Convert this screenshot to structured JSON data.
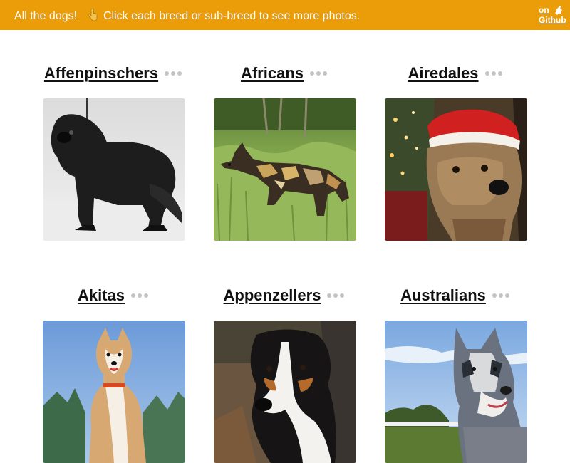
{
  "header": {
    "intro": "All the dogs!",
    "hand_icon": "pointing-down-hand-icon",
    "instruction": "Click each breed or sub-breed to see more photos.",
    "github_line1": "on",
    "github_line2": "Github",
    "github_icon": "puzzle-icon",
    "background_color": "#eb9c09"
  },
  "breeds": [
    {
      "name": "Affenpinschers",
      "photo_alt": "Affenpinscher dog photo"
    },
    {
      "name": "Africans",
      "photo_alt": "African wild dog photo"
    },
    {
      "name": "Airedales",
      "photo_alt": "Airedale dog photo"
    },
    {
      "name": "Akitas",
      "photo_alt": "Akita dog photo"
    },
    {
      "name": "Appenzellers",
      "photo_alt": "Appenzeller dog photo"
    },
    {
      "name": "Australians",
      "photo_alt": "Australian shepherd dog photo"
    }
  ],
  "more_icon": "more-dots-icon"
}
